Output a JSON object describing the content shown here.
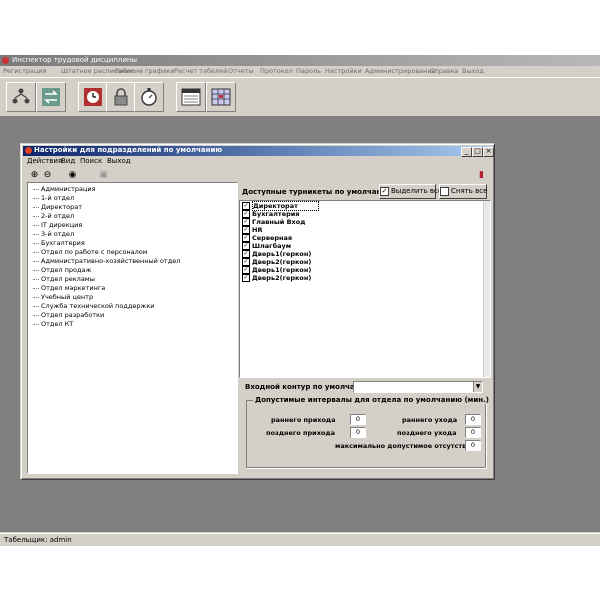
{
  "app": {
    "title": "Инспектор трудовой дисциплины",
    "menu": [
      "Регистрация",
      "Штатное расписание",
      "Рабочие графики",
      "Расчет табелей",
      "Отчеты",
      "Протокол",
      "Пароль",
      "Настройки",
      "Администрирование",
      "Справка",
      "Выход"
    ],
    "toolbar_icons": [
      "users-tree-icon",
      "transfer-icon",
      "calendar-clock-icon",
      "lock-icon",
      "stopwatch-icon",
      "timesheet-icon",
      "schedule-grid-icon"
    ],
    "status": "Табельщик: admin"
  },
  "dialog": {
    "title": "Настройки для подразделений по умолчанию",
    "menu": [
      "Действия",
      "Вид",
      "Поиск",
      "Выход"
    ],
    "window_buttons": [
      "_",
      "□",
      "×"
    ],
    "departments": [
      "Администрация",
      "1-й отдел",
      "Директорат",
      "2-й отдел",
      "IT дирекция",
      "3-й отдел",
      "Бухгалтерия",
      "Отдел по работе с персоналом",
      "Административно-хозяйственный отдел",
      "Отдел продаж",
      "Отдел рекламы",
      "Отдел маркетинга",
      "Учебный центр",
      "Служба технической поддержки",
      "Отдел разработки",
      "Отдел КТ"
    ],
    "turnstiles_label": "Доступные турникеты по умолчанию",
    "select_all_label": "Выделить все",
    "deselect_all_label": "Снять все",
    "turnstiles": [
      {
        "name": "Директорат",
        "checked": true
      },
      {
        "name": "Бухгалтерия",
        "checked": true
      },
      {
        "name": "Главный Вход",
        "checked": true
      },
      {
        "name": "HR",
        "checked": true
      },
      {
        "name": "Серверная",
        "checked": true
      },
      {
        "name": "Шлагбаум",
        "checked": true
      },
      {
        "name": "Дверь1(геркон)",
        "checked": true
      },
      {
        "name": "Дверь2(геркон)",
        "checked": true
      },
      {
        "name": "Дверь1(геркон)",
        "checked": true
      },
      {
        "name": "Дверь2(геркон)",
        "checked": true
      }
    ],
    "input_contour_label": "Входной контур по умолчанию",
    "input_contour_value": "",
    "intervals": {
      "title": "Допустимые интервалы для отдела по умолчанию (мин.)",
      "early_arrival_label": "раннего прихода",
      "early_arrival": "0",
      "late_arrival_label": "позднего прихода",
      "late_arrival": "0",
      "early_departure_label": "раннего ухода",
      "early_departure": "0",
      "late_departure_label": "позднего ухода",
      "late_departure": "0",
      "max_absence_label": "максимально допустимое отсутствие",
      "max_absence": "0"
    }
  }
}
